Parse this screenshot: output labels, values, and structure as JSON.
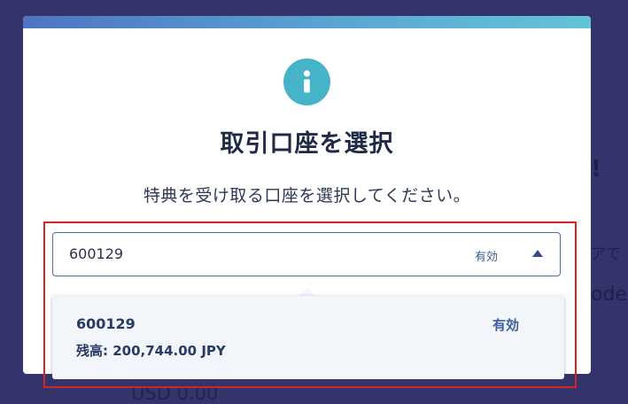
{
  "background": {
    "heading_fragment": "!",
    "text_fragment": "アで",
    "code_fragment": "ode",
    "balance_fragment": "USD 0.00"
  },
  "modal": {
    "icon": "info-icon",
    "title": "取引口座を選択",
    "subtitle": "特典を受け取る口座を選択してください。",
    "select": {
      "value": "600129",
      "status": "有効",
      "expanded": true
    },
    "options": [
      {
        "account": "600129",
        "balance": "残高: 200,744.00 JPY",
        "status": "有効"
      }
    ]
  },
  "colors": {
    "accent": "#45b4c9",
    "highlight": "#d42525",
    "backdrop": "#34346c"
  }
}
